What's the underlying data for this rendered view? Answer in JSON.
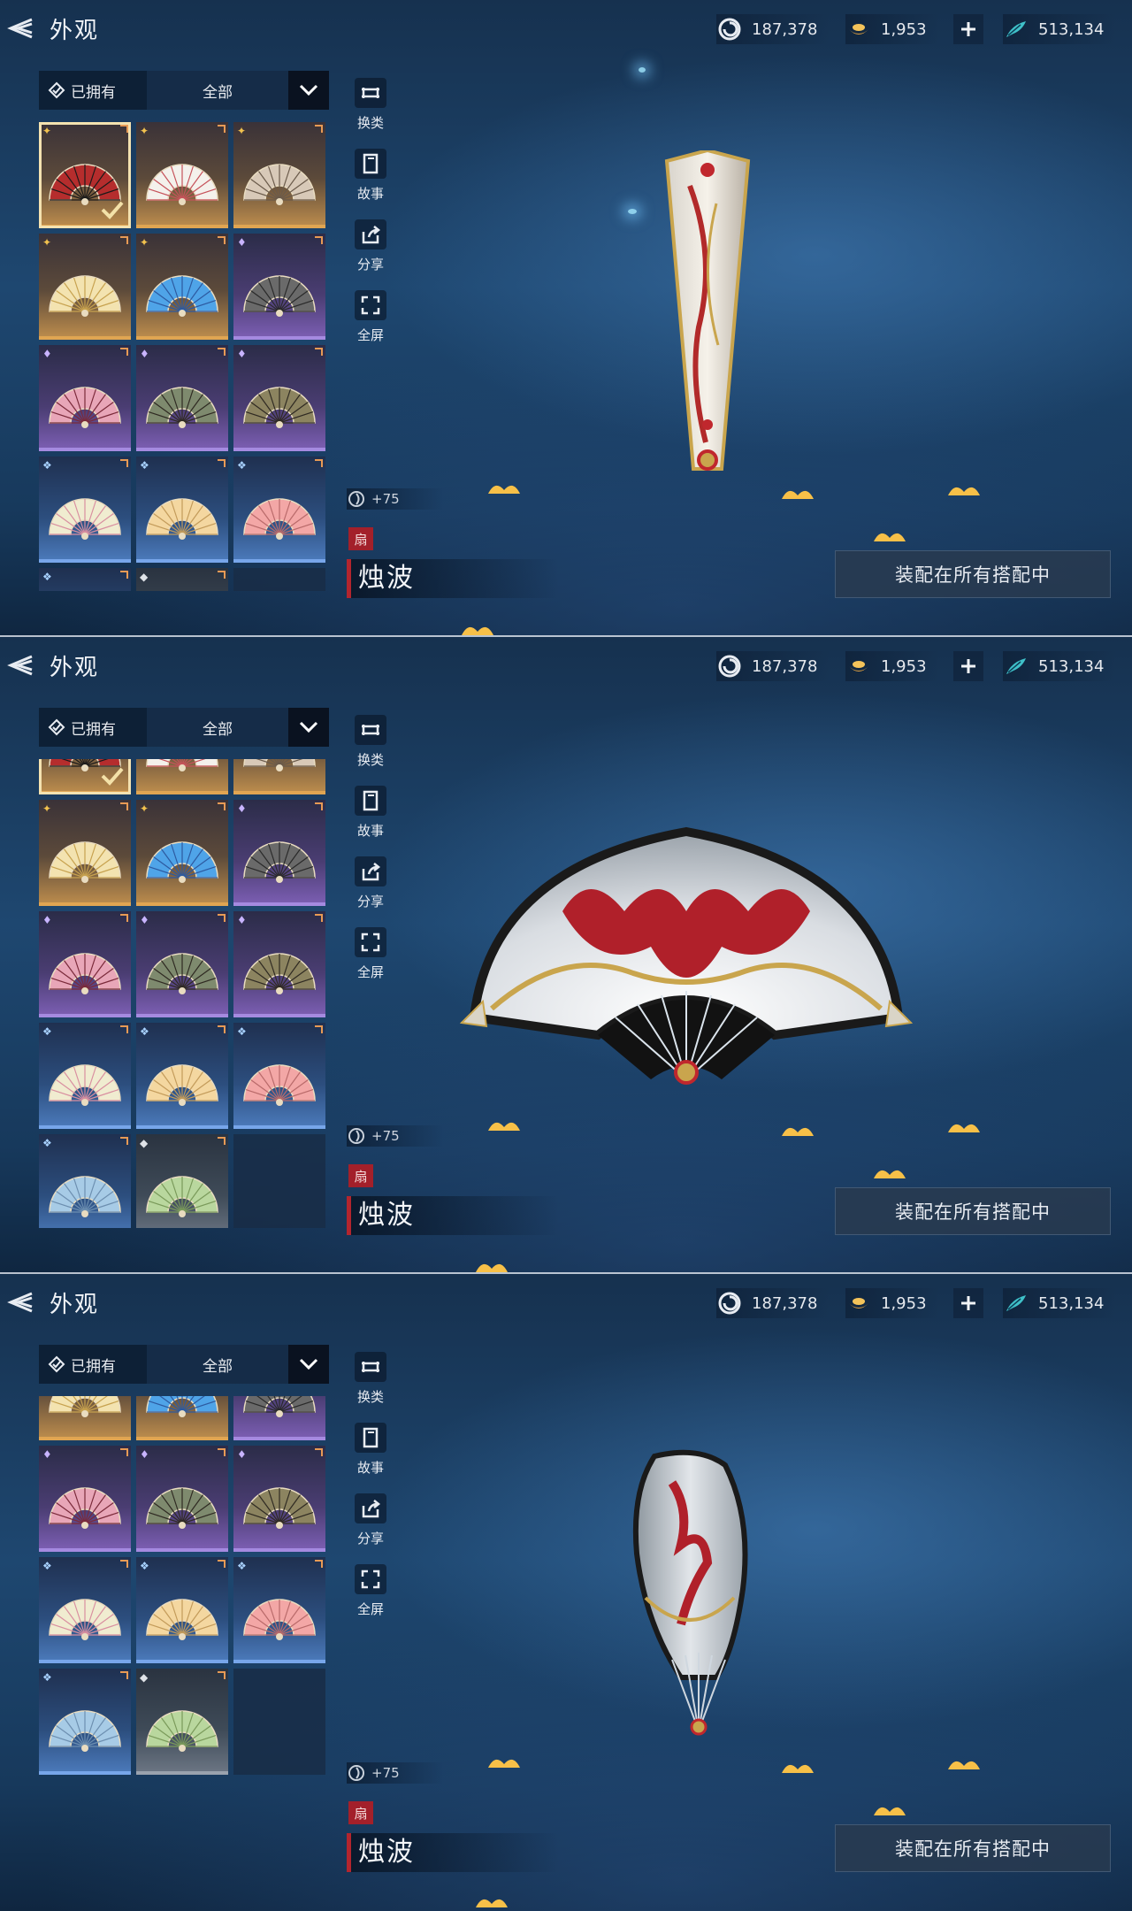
{
  "header": {
    "title": "外观",
    "currencies": [
      {
        "icon": "spiral-coin-icon",
        "value": "187,378"
      },
      {
        "icon": "gold-ingot-icon",
        "value": "1,953"
      },
      {
        "icon": "jade-feather-icon",
        "value": "513,134"
      }
    ]
  },
  "filter": {
    "owned_label": "已拥有",
    "category_label": "全部"
  },
  "tools": [
    {
      "icon": "swap-category-icon",
      "label": "换类"
    },
    {
      "icon": "story-book-icon",
      "label": "故事"
    },
    {
      "icon": "share-icon",
      "label": "分享"
    },
    {
      "icon": "fullscreen-icon",
      "label": "全屏"
    }
  ],
  "item": {
    "score": "+75",
    "type": "扇",
    "name": "烛波"
  },
  "equip_button": "装配在所有搭配中",
  "colors": {
    "gold_rarity": "#e0a552",
    "purple_rarity": "#a58ae0",
    "blue_rarity": "#77a6ea",
    "gray_rarity": "#9aa2ae",
    "name_accent": "#b3252e"
  },
  "fans": [
    {
      "rarity": "gold",
      "tone": "#b52d2d",
      "rib": "#1a1a1a",
      "selected": true
    },
    {
      "rarity": "gold",
      "tone": "#f4f1ec",
      "rib": "#c6525a",
      "selected": false
    },
    {
      "rarity": "gold",
      "tone": "#d8c9b8",
      "rib": "#6a5a4a",
      "selected": false
    },
    {
      "rarity": "gold",
      "tone": "#f3e3b0",
      "rib": "#c7a24f",
      "selected": false
    },
    {
      "rarity": "gold",
      "tone": "#4fa4e8",
      "rib": "#2d5aa0",
      "selected": false
    },
    {
      "rarity": "purple",
      "tone": "#6a6a6a",
      "rib": "#2a2a2a",
      "selected": false
    },
    {
      "rarity": "purple",
      "tone": "#e8a6b8",
      "rib": "#7a2a3a",
      "selected": false
    },
    {
      "rarity": "purple",
      "tone": "#7e8a6e",
      "rib": "#2f2a22",
      "selected": false
    },
    {
      "rarity": "purple",
      "tone": "#8c8460",
      "rib": "#2f2a22",
      "selected": false
    },
    {
      "rarity": "blue",
      "tone": "#f0ecd0",
      "rib": "#d98fa0",
      "selected": false
    },
    {
      "rarity": "blue",
      "tone": "#f4d7a0",
      "rib": "#c39b5a",
      "selected": false
    },
    {
      "rarity": "blue",
      "tone": "#f3a7a6",
      "rib": "#b96a6a",
      "selected": false
    },
    {
      "rarity": "blue",
      "tone": "#a7cbe6",
      "rib": "#6d8fb0",
      "selected": false
    },
    {
      "rarity": "gray",
      "tone": "#b9d79e",
      "rib": "#7a9a5a",
      "selected": false
    },
    {
      "rarity": "empty"
    }
  ]
}
